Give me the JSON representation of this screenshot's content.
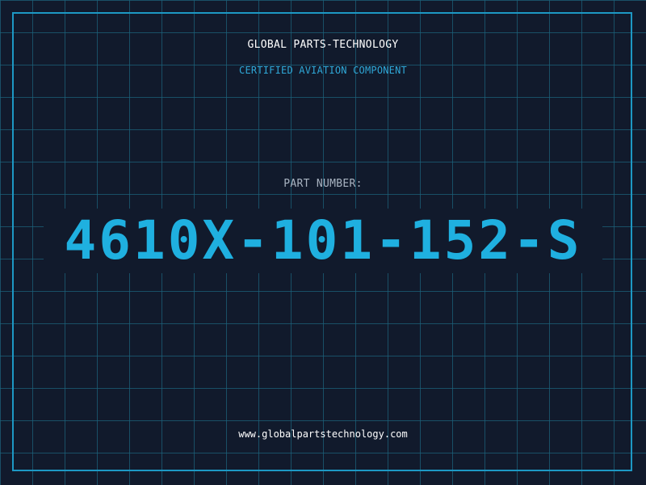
{
  "header": {
    "company": "GLOBAL PARTS-TECHNOLOGY",
    "subtitle": "CERTIFIED AVIATION COMPONENT"
  },
  "part": {
    "label": "PART NUMBER:",
    "number": "4610X-101-152-S"
  },
  "footer": {
    "website": "www.globalpartstechnology.com"
  },
  "colors": {
    "background": "#111a2c",
    "grid": "#1c607a",
    "accent": "#1fb0e0",
    "border": "#1d98c4",
    "text": "#ffffff",
    "muted": "#a9b4c2"
  }
}
